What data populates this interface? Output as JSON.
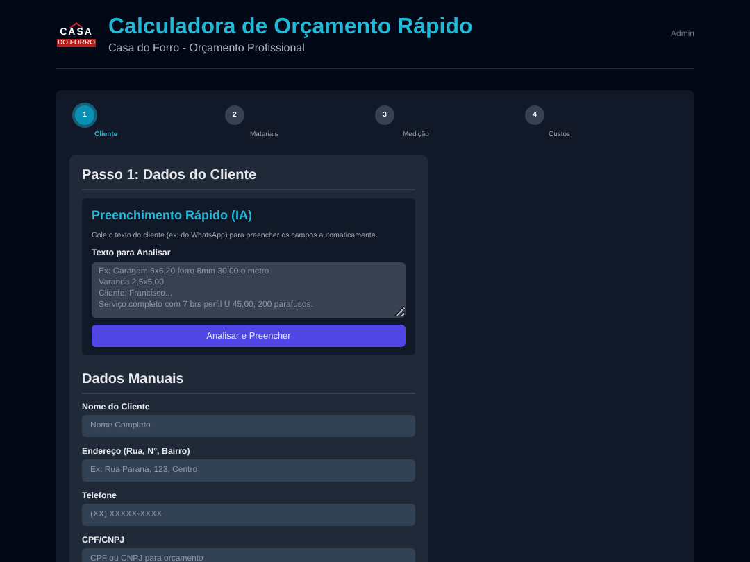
{
  "header": {
    "logo": {
      "text": "CASA",
      "subtext": "DO FORRO"
    },
    "title": "Calculadora de Orçamento Rápido",
    "subtitle": "Casa do Forro - Orçamento Profissional",
    "user": "Admin"
  },
  "steps": [
    {
      "number": "1",
      "label": "Cliente",
      "selected": true
    },
    {
      "number": "2",
      "label": "Materiais",
      "selected": false
    },
    {
      "number": "3",
      "label": "Medição",
      "selected": false
    },
    {
      "number": "4",
      "label": "Custos",
      "selected": false
    }
  ],
  "panel": {
    "title": "Passo 1: Dados do Cliente",
    "quick_fill": {
      "title": "Preenchimento Rápido (IA)",
      "description": "Cole o texto do cliente (ex: do WhatsApp) para preencher os campos automaticamente.",
      "field_label": "Texto para Analisar",
      "placeholder": "Ex: Garagem 6x6,20 forro 8mm 30,00 o metro\nVaranda 2,5x5,00\nCliente: Francisco...\nServiço completo com 7 brs perfil U 45,00, 200 parafusos.",
      "button": "Analisar e Preencher"
    },
    "manual": {
      "title": "Dados Manuais",
      "fields": [
        {
          "label": "Nome do Cliente",
          "placeholder": "Nome Completo"
        },
        {
          "label": "Endereço (Rua, N°, Bairro)",
          "placeholder": "Ex: Rua Paraná, 123, Centro"
        },
        {
          "label": "Telefone",
          "placeholder": "(XX) XXXXX-XXXX"
        },
        {
          "label": "CPF/CNPJ",
          "placeholder": "CPF ou CNPJ para orçamento"
        }
      ]
    }
  }
}
